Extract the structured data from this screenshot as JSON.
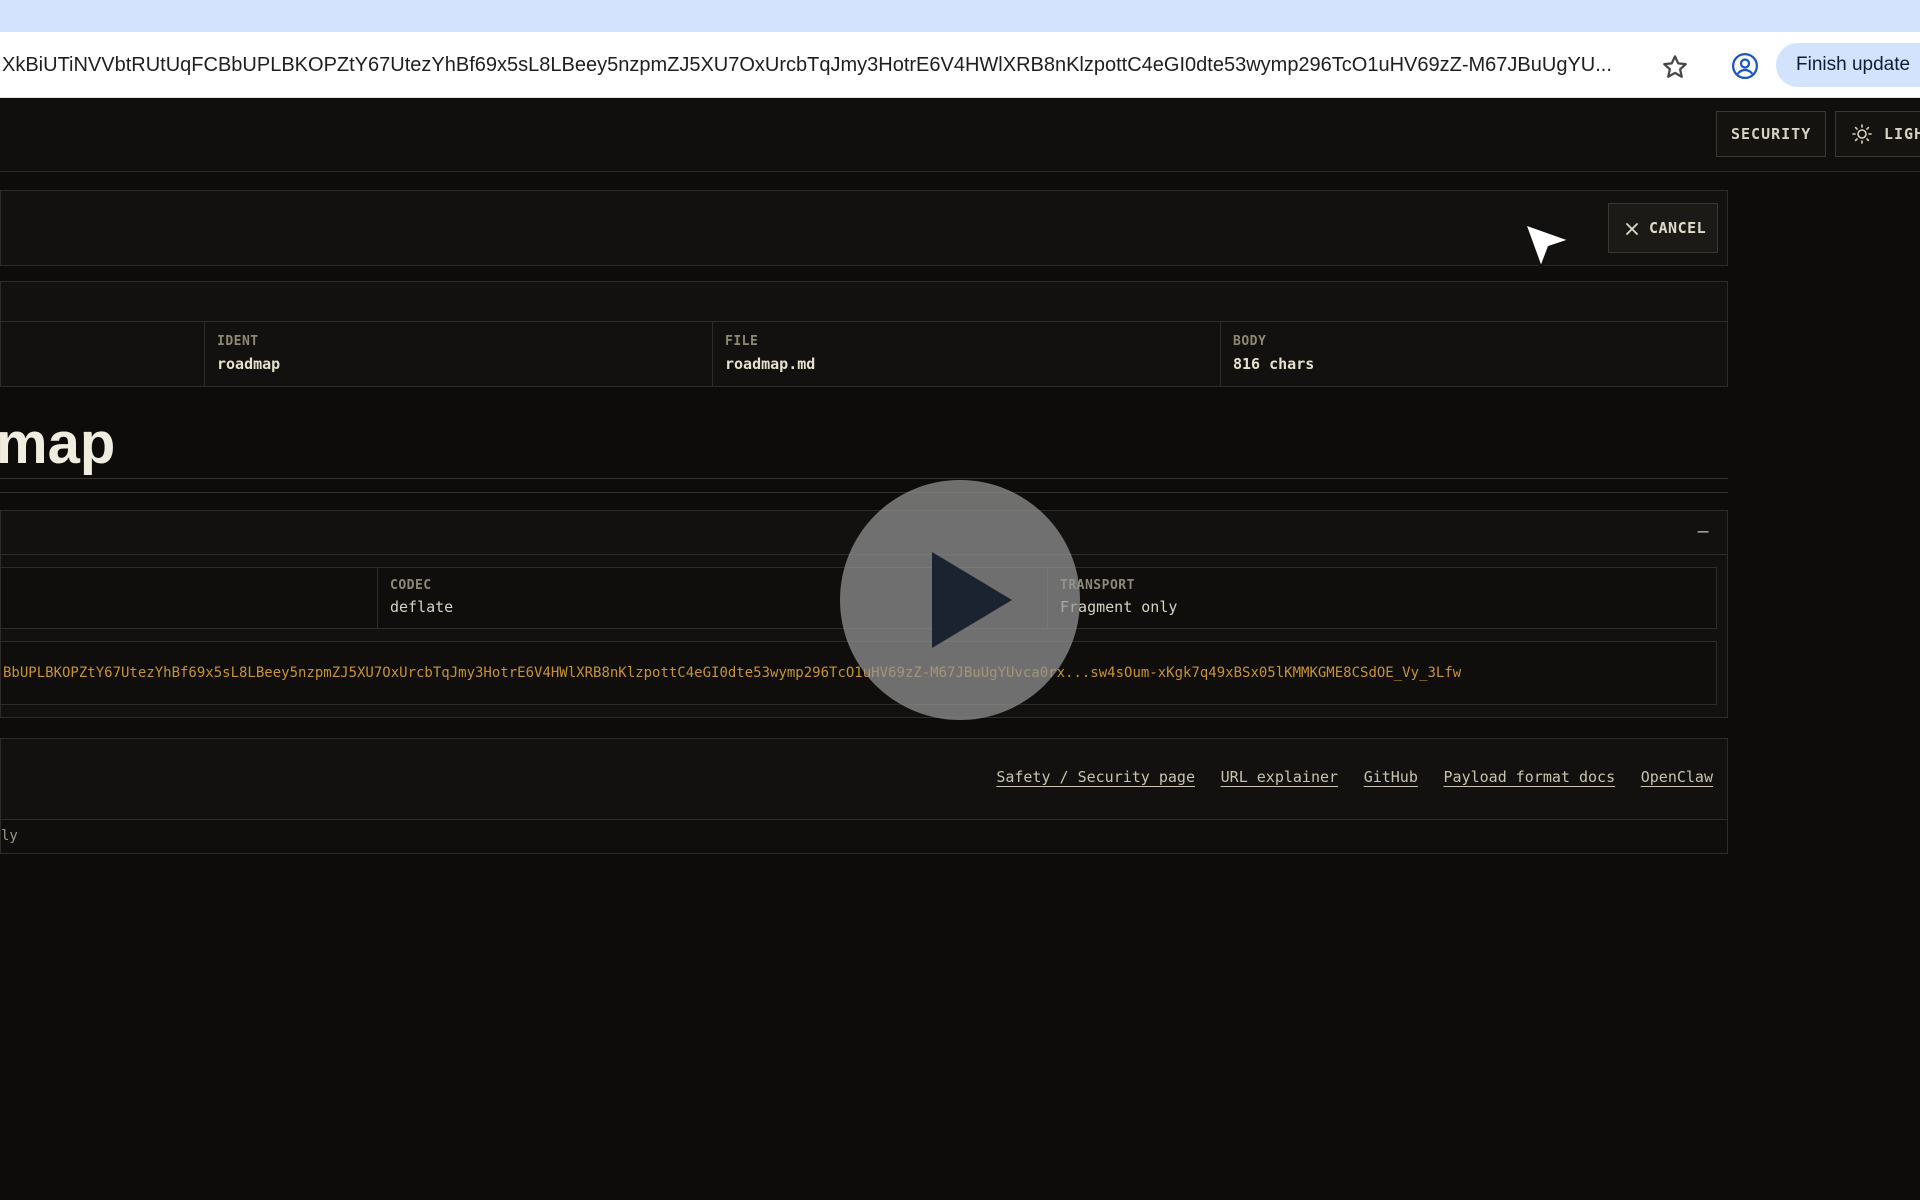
{
  "browser": {
    "url": "XkBiUTiNVVbtRUtUqFCBbUPLBKOPZtY67UtezYhBf69x5sL8LBeey5nzpmZJ5XU7OxUrcbTqJmy3HotrE6V4HWlXRB8nKlzpottC4eGI0dte53wymp296TcO1uHV69zZ-M67JBuUgYU...",
    "finish_update_label": "Finish update"
  },
  "header": {
    "security_label": "SECURITY",
    "light_label": "LIGH"
  },
  "top_panel": {
    "cancel_label": "CANCEL"
  },
  "meta": {
    "cells": [
      {
        "label": "IDENT",
        "value": "roadmap"
      },
      {
        "label": "FILE",
        "value": "roadmap.md"
      },
      {
        "label": "BODY",
        "value": "816 chars"
      }
    ]
  },
  "document": {
    "title_visible": "map"
  },
  "payload": {
    "collapse_label": "–",
    "codec_label": "CODEC",
    "codec_value": "deflate",
    "transport_label": "TRANSPORT",
    "transport_value": "Fragment only",
    "url_text": "BbUPLBKOPZtY67UtezYhBf69x5sL8LBeey5nzpmZJ5XU7OxUrcbTqJmy3HotrE6V4HWlXRB8nKlzpottC4eGI0dte53wymp296TcO1uHV69zZ-M67JBuUgYUvca0rx...sw4sOum-xKgk7q49xBSx05lKMMKGME8CSdOE_Vy_3Lfw"
  },
  "footer": {
    "links": [
      "Safety / Security page",
      "URL explainer",
      "GitHub",
      "Payload format docs",
      "OpenClaw"
    ],
    "sub_text": "ly"
  },
  "icons": {
    "star": "star-icon",
    "profile": "profile-icon",
    "sun": "sun-icon",
    "close": "close-icon",
    "play": "play-icon",
    "cursor": "cursor-icon"
  },
  "colors": {
    "background": "#0d0c0a",
    "accent_url": "#c8922e",
    "chrome_blue": "#d3e3fd"
  }
}
